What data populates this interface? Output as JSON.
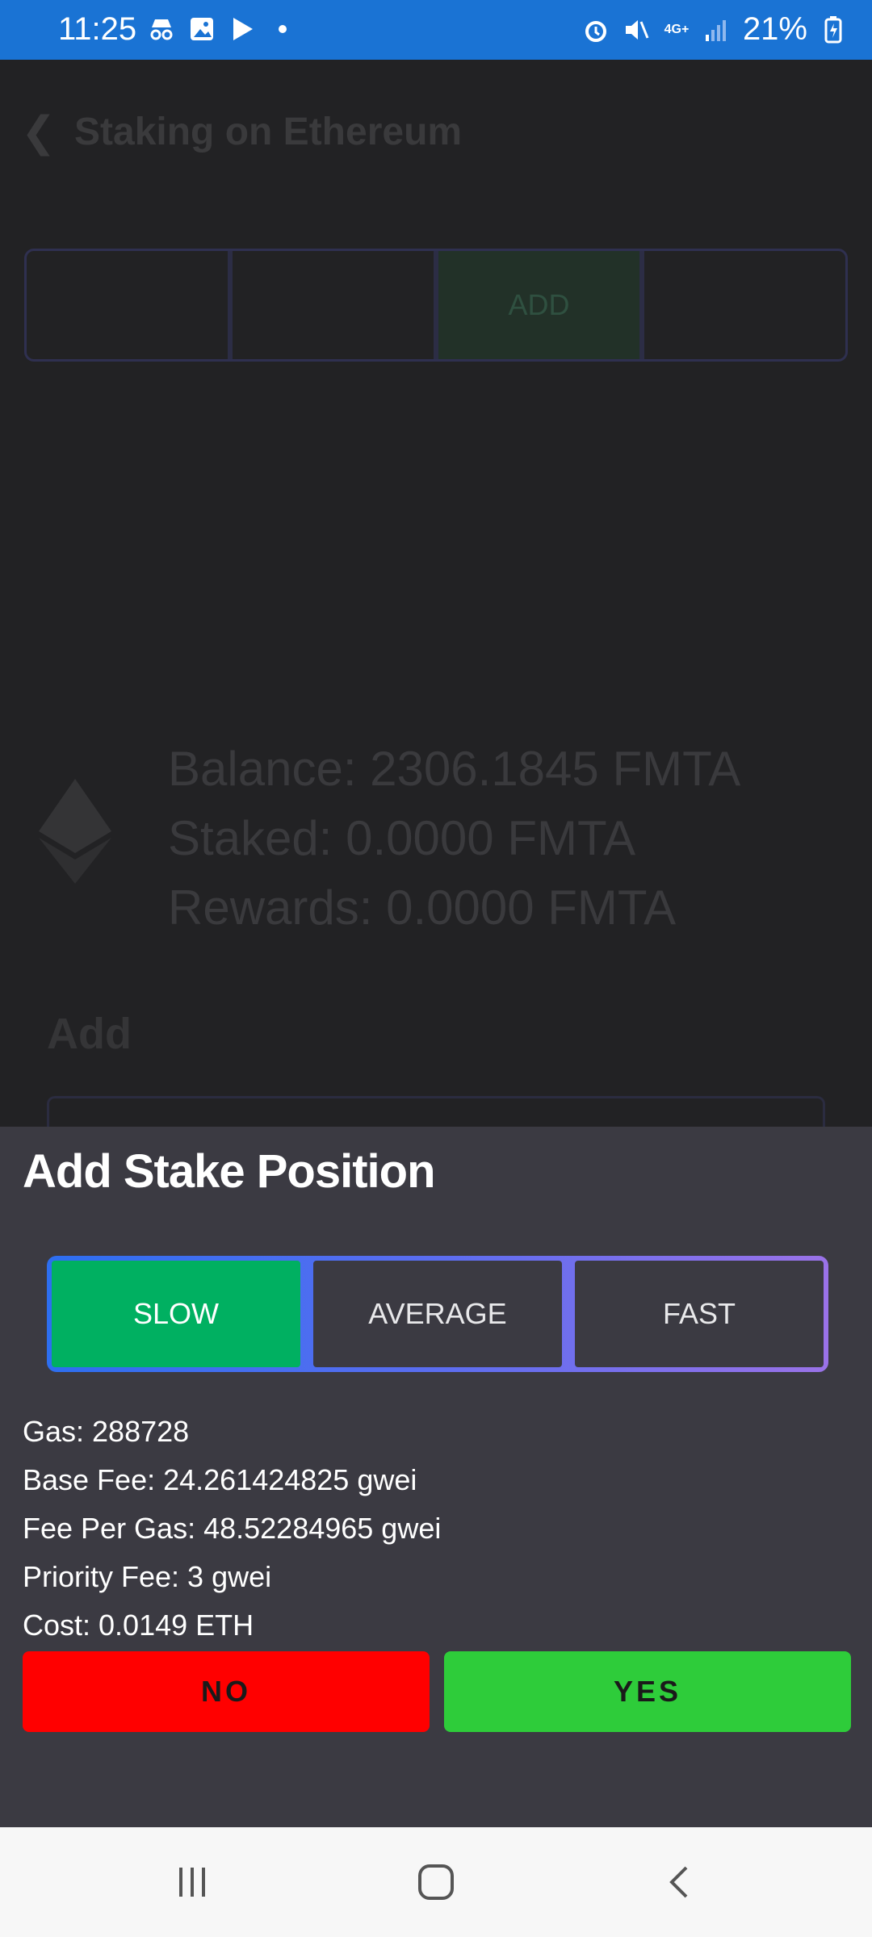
{
  "status_bar": {
    "time": "11:25",
    "battery": "21%",
    "network": "4G+"
  },
  "background": {
    "title": "Staking on Ethereum",
    "tabs": [
      "",
      "",
      "ADD",
      ""
    ],
    "balance": "Balance: 2306.1845 FMTA",
    "staked": "Staked: 0.0000 FMTA",
    "rewards": "Rewards: 0.0000 FMTA",
    "section": "Add"
  },
  "sheet": {
    "title": "Add Stake Position",
    "speeds": [
      "SLOW",
      "AVERAGE",
      "FAST"
    ],
    "selected_speed": "SLOW",
    "gas": "Gas: 288728",
    "base_fee": "Base Fee: 24.261424825 gwei",
    "fee_per_gas": "Fee Per Gas: 48.52284965 gwei",
    "priority_fee": "Priority Fee: 3 gwei",
    "cost": "Cost: 0.0149 ETH",
    "no_label": "NO",
    "yes_label": "YES"
  },
  "colors": {
    "status_bar": "#1a73d4",
    "selected_speed": "#00b061",
    "no_button": "#ff0000",
    "yes_button": "#2ecc3a"
  }
}
